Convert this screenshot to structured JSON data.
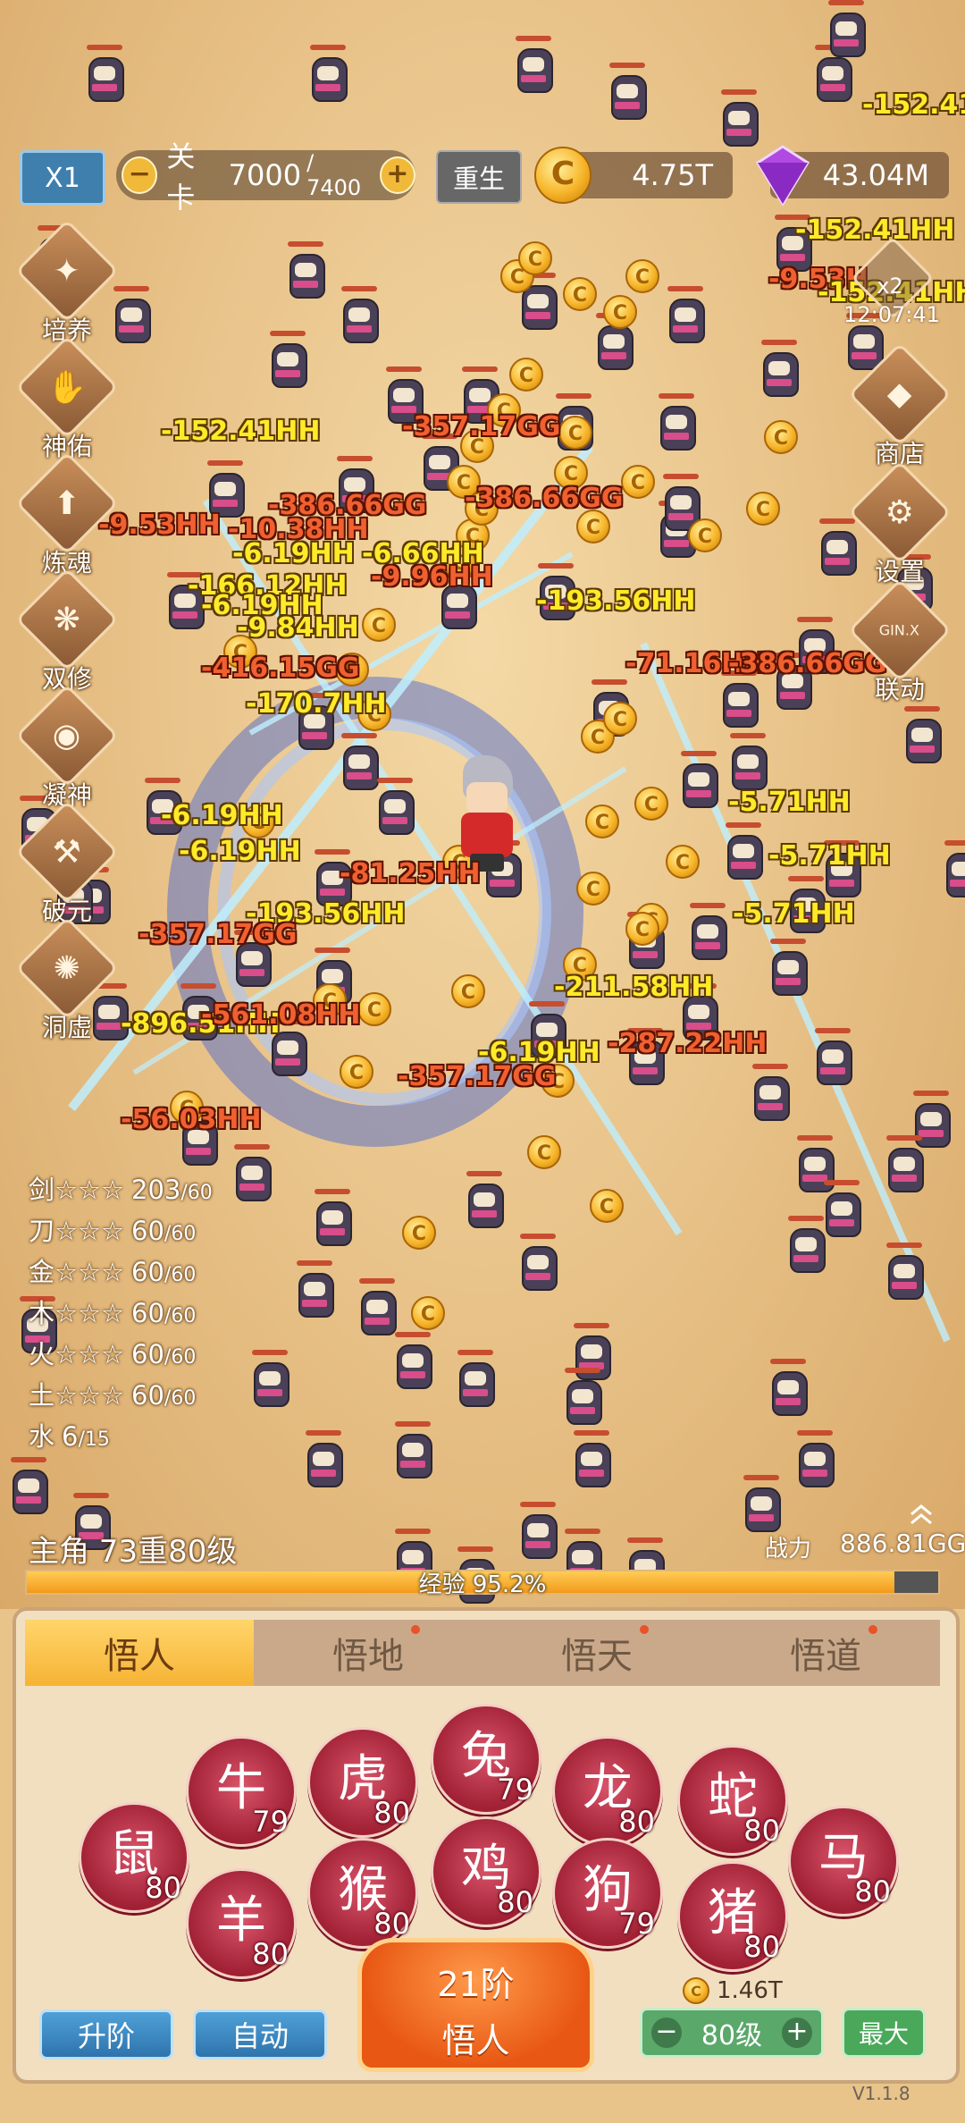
{
  "hud": {
    "speed": "X1",
    "stage_label": "关卡",
    "stage_current": "7000",
    "stage_total": "/ 7400",
    "rebirth": "重生",
    "gold": "4.75T",
    "gems": "43.04M",
    "coin_glyph": "C"
  },
  "left_menu": [
    {
      "label": "培养",
      "icon": "cultivate-icon"
    },
    {
      "label": "神佑",
      "icon": "blessing-icon"
    },
    {
      "label": "炼魂",
      "icon": "soul-refine-icon"
    },
    {
      "label": "双修",
      "icon": "dual-cultivation-icon"
    },
    {
      "label": "凝神",
      "icon": "focus-icon"
    },
    {
      "label": "破元",
      "icon": "break-icon"
    },
    {
      "label": "洞虚",
      "icon": "void-icon"
    }
  ],
  "right_menu": {
    "speed_badge": "x2",
    "timer": "12:07:41",
    "shop": "商店",
    "settings": "设置",
    "link": "联动",
    "link_icon_text": "GIN.X"
  },
  "damage_numbers": [
    {
      "text": "-152.41",
      "color": "yellow"
    },
    {
      "text": "-152.41HH",
      "color": "yellow"
    },
    {
      "text": "-9.53H",
      "color": "red"
    },
    {
      "text": "-152.41HH",
      "color": "yellow"
    },
    {
      "text": "-357.17GG",
      "color": "red"
    },
    {
      "text": "-152.41HH",
      "color": "yellow"
    },
    {
      "text": "-386.66GG",
      "color": "red"
    },
    {
      "text": "-386.66GG",
      "color": "red"
    },
    {
      "text": "-9.53HH",
      "color": "red"
    },
    {
      "text": "-10.38HH",
      "color": "red"
    },
    {
      "text": "-6.19HH",
      "color": "yellow"
    },
    {
      "text": "-6.66HH",
      "color": "yellow"
    },
    {
      "text": "-166.12HH",
      "color": "yellow"
    },
    {
      "text": "-9.96HH",
      "color": "red"
    },
    {
      "text": "-193.56HH",
      "color": "yellow"
    },
    {
      "text": "-6.19HH",
      "color": "yellow"
    },
    {
      "text": "-9.84HH",
      "color": "yellow"
    },
    {
      "text": "-416.15GG",
      "color": "red"
    },
    {
      "text": "-170.7HH",
      "color": "yellow"
    },
    {
      "text": "-71.16HH",
      "color": "red"
    },
    {
      "text": "-386.66GG",
      "color": "red"
    },
    {
      "text": "-6.19HH",
      "color": "yellow"
    },
    {
      "text": "-5.71HH",
      "color": "yellow"
    },
    {
      "text": "-5.71HH",
      "color": "yellow"
    },
    {
      "text": "-5.71HH",
      "color": "yellow"
    },
    {
      "text": "-6.19HH",
      "color": "yellow"
    },
    {
      "text": "-81.25HH",
      "color": "red"
    },
    {
      "text": "-193.56HH",
      "color": "yellow"
    },
    {
      "text": "-357.17GG",
      "color": "red"
    },
    {
      "text": "-211.58HH",
      "color": "yellow"
    },
    {
      "text": "-896.51HH",
      "color": "yellow"
    },
    {
      "text": "-561.08HH",
      "color": "red"
    },
    {
      "text": "-6.19HH",
      "color": "yellow"
    },
    {
      "text": "-357.17GG",
      "color": "red"
    },
    {
      "text": "-56.03HH",
      "color": "red"
    },
    {
      "text": "-287.22HH",
      "color": "red"
    }
  ],
  "skills": [
    {
      "name": "剑☆☆☆",
      "value": "203",
      "max": "/60"
    },
    {
      "name": "刀☆☆☆",
      "value": "60",
      "max": "/60"
    },
    {
      "name": "金☆☆☆",
      "value": "60",
      "max": "/60"
    },
    {
      "name": "木☆☆☆",
      "value": "60",
      "max": "/60"
    },
    {
      "name": "火☆☆☆",
      "value": "60",
      "max": "/60"
    },
    {
      "name": "土☆☆☆",
      "value": "60",
      "max": "/60"
    },
    {
      "name": "水",
      "value": "6",
      "max": "/15"
    }
  ],
  "hero": {
    "title": "主角 73重80级",
    "power_label": "战力",
    "power_value": "886.81GG",
    "exp_text": "经验 95.2%",
    "exp_fraction": 0.952
  },
  "panel": {
    "tabs": [
      {
        "label": "悟人",
        "active": true,
        "dot": false
      },
      {
        "label": "悟地",
        "active": false,
        "dot": true
      },
      {
        "label": "悟天",
        "active": false,
        "dot": true
      },
      {
        "label": "悟道",
        "active": false,
        "dot": true
      }
    ],
    "zodiac": [
      {
        "name": "rat",
        "glyph": "鼠",
        "level": "80"
      },
      {
        "name": "ox",
        "glyph": "牛",
        "level": "79"
      },
      {
        "name": "goat",
        "glyph": "羊",
        "level": "80"
      },
      {
        "name": "tiger",
        "glyph": "虎",
        "level": "80"
      },
      {
        "name": "monkey",
        "glyph": "猴",
        "level": "80"
      },
      {
        "name": "rabbit",
        "glyph": "兔",
        "level": "79"
      },
      {
        "name": "rooster",
        "glyph": "鸡",
        "level": "80"
      },
      {
        "name": "dragon",
        "glyph": "龙",
        "level": "80"
      },
      {
        "name": "dog",
        "glyph": "狗",
        "level": "79"
      },
      {
        "name": "snake",
        "glyph": "蛇",
        "level": "80"
      },
      {
        "name": "pig",
        "glyph": "猪",
        "level": "80"
      },
      {
        "name": "horse",
        "glyph": "马",
        "level": "80"
      }
    ],
    "upgrade": "升阶",
    "auto": "自动",
    "big_button_line1": "21阶",
    "big_button_line2": "悟人",
    "cost": "1.46T",
    "level_value": "80级",
    "max": "最大",
    "version": "V1.1.8"
  }
}
